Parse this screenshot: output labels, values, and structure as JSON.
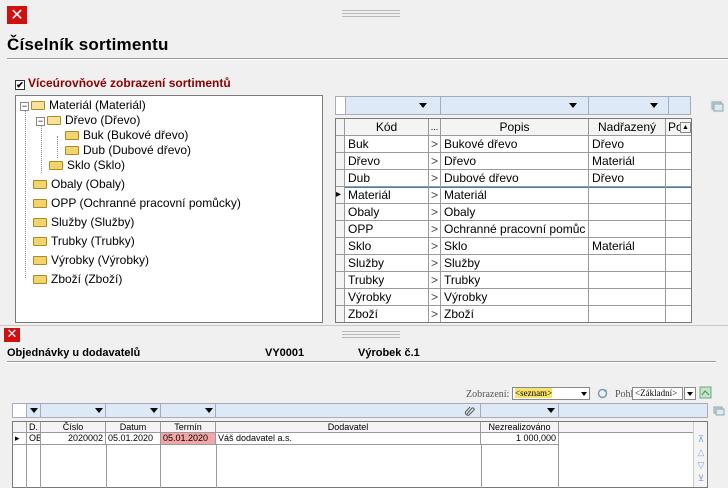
{
  "top_window": {
    "close_glyph": "✕",
    "title": "Číselník sortimentu",
    "checkbox_label": "Víceúrovňové zobrazení sortimentů",
    "tree": [
      {
        "label": "Materiál (Materiál)",
        "level": 0,
        "expanded": true
      },
      {
        "label": "Dřevo (Dřevo)",
        "level": 1,
        "expanded": true
      },
      {
        "label": "Buk (Bukové dřevo)",
        "level": 2
      },
      {
        "label": "Dub (Dubové dřevo)",
        "level": 2
      },
      {
        "label": "Sklo (Sklo)",
        "level": 1
      },
      {
        "label": "Obaly (Obaly)",
        "level": 0
      },
      {
        "label": "OPP (Ochranné pracovní pomůcky)",
        "level": 0
      },
      {
        "label": "Služby (Služby)",
        "level": 0
      },
      {
        "label": "Trubky (Trubky)",
        "level": 0
      },
      {
        "label": "Výrobky (Výrobky)",
        "level": 0
      },
      {
        "label": "Zboží (Zboží)",
        "level": 0
      }
    ],
    "grid": {
      "headers": {
        "kod": "Kód",
        "dots": "...",
        "popis": "Popis",
        "nadrazeny": "Nadřazený",
        "pouz": "Použ"
      },
      "rows": [
        {
          "kod": "Buk",
          "arrow": ">",
          "popis": "Bukové dřevo",
          "nadrazeny": "Dřevo"
        },
        {
          "kod": "Dřevo",
          "arrow": ">",
          "popis": "Dřevo",
          "nadrazeny": "Materiál"
        },
        {
          "kod": "Dub",
          "arrow": ">",
          "popis": "Dubové dřevo",
          "nadrazeny": "Dřevo"
        },
        {
          "kod": "Materiál",
          "arrow": ">",
          "popis": "Materiál",
          "nadrazeny": "",
          "selected": true
        },
        {
          "kod": "Obaly",
          "arrow": ">",
          "popis": "Obaly",
          "nadrazeny": ""
        },
        {
          "kod": "OPP",
          "arrow": ">",
          "popis": "Ochranné pracovní pomůc",
          "nadrazeny": ""
        },
        {
          "kod": "Sklo",
          "arrow": ">",
          "popis": "Sklo",
          "nadrazeny": "Materiál"
        },
        {
          "kod": "Služby",
          "arrow": ">",
          "popis": "Služby",
          "nadrazeny": ""
        },
        {
          "kod": "Trubky",
          "arrow": ">",
          "popis": "Trubky",
          "nadrazeny": ""
        },
        {
          "kod": "Výrobky",
          "arrow": ">",
          "popis": "Výrobky",
          "nadrazeny": ""
        },
        {
          "kod": "Zboží",
          "arrow": ">",
          "popis": "Zboží",
          "nadrazeny": ""
        }
      ]
    }
  },
  "bottom_window": {
    "close_glyph": "✕",
    "title": "Objednávky u dodavatelů",
    "code": "VY0001",
    "product": "Výrobek č.1",
    "zobrazeni_label": "Zobrazení:",
    "zobrazeni_value": "<seznam>",
    "pohled_label": "Pohled:",
    "pohled_value": "<Základní>",
    "grid": {
      "headers": {
        "d": "D.",
        "cislo": "Číslo",
        "datum": "Datum",
        "termin": "Termín",
        "dodavatel": "Dodavatel",
        "nezrealizovano": "Nezrealizováno"
      },
      "rows": [
        {
          "d": "OB",
          "cislo": "2020002",
          "datum": "05.01.2020",
          "termin": "05.01.2020",
          "dodavatel": "Váš dodavatel a.s.",
          "nezrealizovano": "1 000,000"
        }
      ]
    }
  },
  "colors": {
    "close": "#d01010",
    "filter_bar": "#dde9f7",
    "title_red": "#8b0000",
    "overdue": "#f4a6a6"
  }
}
